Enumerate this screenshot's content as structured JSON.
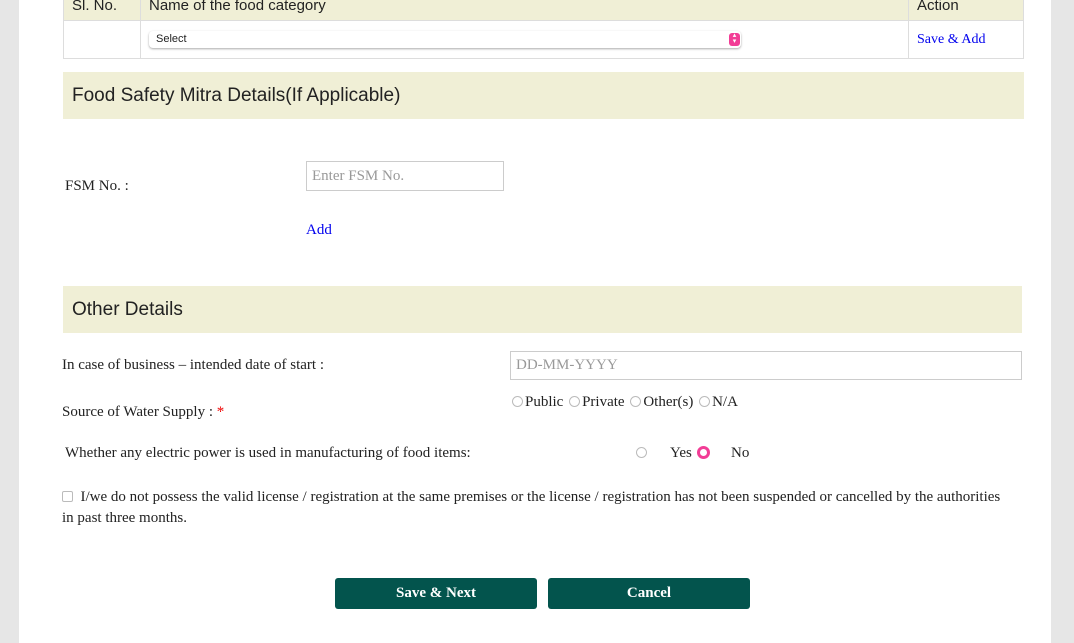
{
  "table": {
    "headers": [
      "Sl. No.",
      "Name of the food category",
      "Action"
    ],
    "select_value": "Select",
    "action_link": "Save & Add"
  },
  "fsm": {
    "title": "Food Safety Mitra Details(If Applicable)",
    "label": "FSM No. :",
    "placeholder": "Enter FSM No.",
    "add_link": "Add"
  },
  "other": {
    "title": "Other Details",
    "date_label": "In case of business – intended date of start :",
    "date_placeholder": "DD-MM-YYYY",
    "water_label": "Source of Water Supply :",
    "required_mark": "*",
    "water_options": [
      "Public",
      "Private",
      "Other(s)",
      "N/A"
    ],
    "power_label": "Whether any electric power is used in manufacturing of food items:",
    "power_options": [
      "Yes",
      "No"
    ],
    "power_selected": "No",
    "declaration": "I/we do not possess the valid license / registration at the same premises or the license / registration has not been suspended or cancelled by the authorities in past three months.",
    "declaration_checked": false
  },
  "buttons": {
    "save_next": "Save & Next",
    "cancel": "Cancel"
  },
  "colors": {
    "accent": "#f23d96",
    "button": "#03544d",
    "band": "#f0efd6",
    "link": "#0000ee"
  }
}
